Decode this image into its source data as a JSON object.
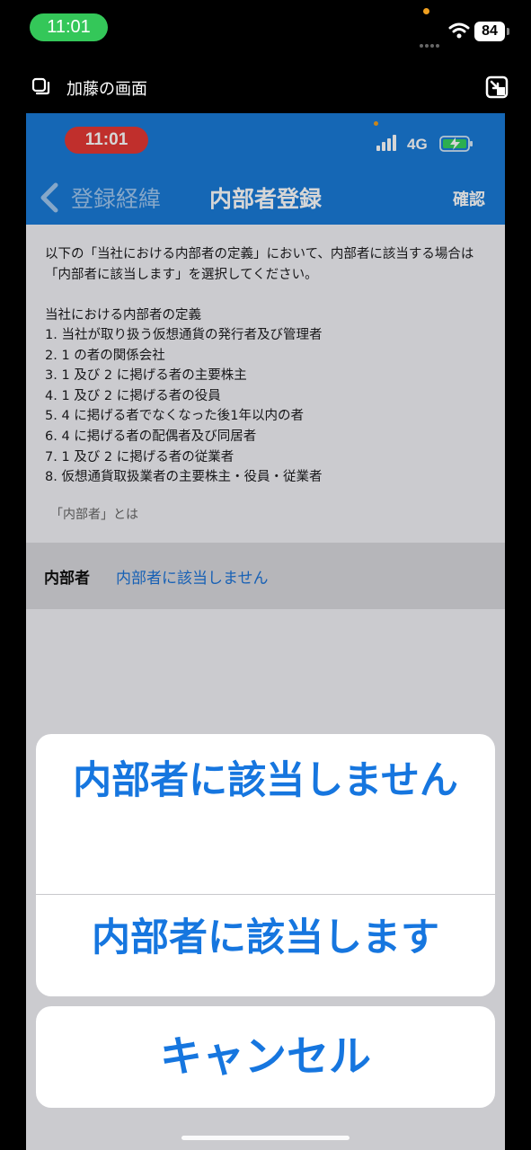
{
  "outer_status": {
    "time": "11:01",
    "battery": "84"
  },
  "share": {
    "title": "加藤の画面"
  },
  "inner_status": {
    "time": "11:01",
    "network": "4G"
  },
  "navigation": {
    "back_label": "登録経緯",
    "title": "内部者登録",
    "confirm_label": "確認"
  },
  "content": {
    "notice": "以下の「当社における内部者の定義」において、内部者に該当する場合は「内部者に該当します」を選択してください。",
    "definition_title": "当社における内部者の定義",
    "definitions": [
      "1.  当社が取り扱う仮想通貨の発行者及び管理者",
      "2.  1 の者の関係会社",
      "3.  1 及び 2 に掲げる者の主要株主",
      "4.  1 及び 2 に掲げる者の役員",
      "5.  4 に掲げる者でなくなった後1年以内の者",
      "6.  4 に掲げる者の配偶者及び同居者",
      "7.  1 及び 2 に掲げる者の従業者",
      "8.  仮想通貨取扱業者の主要株主・役員・従業者"
    ],
    "insider_link": "「内部者」とは",
    "insider_row_label": "内部者",
    "insider_row_value": "内部者に該当しません"
  },
  "action_sheet": {
    "option_not_applicable": "内部者に該当しません",
    "option_applicable": "内部者に該当します",
    "cancel": "キャンセル"
  },
  "colors": {
    "header_blue": "#1a7bd8",
    "link_blue": "#1b73d8",
    "status_green": "#34c759",
    "status_red": "#e53935"
  }
}
